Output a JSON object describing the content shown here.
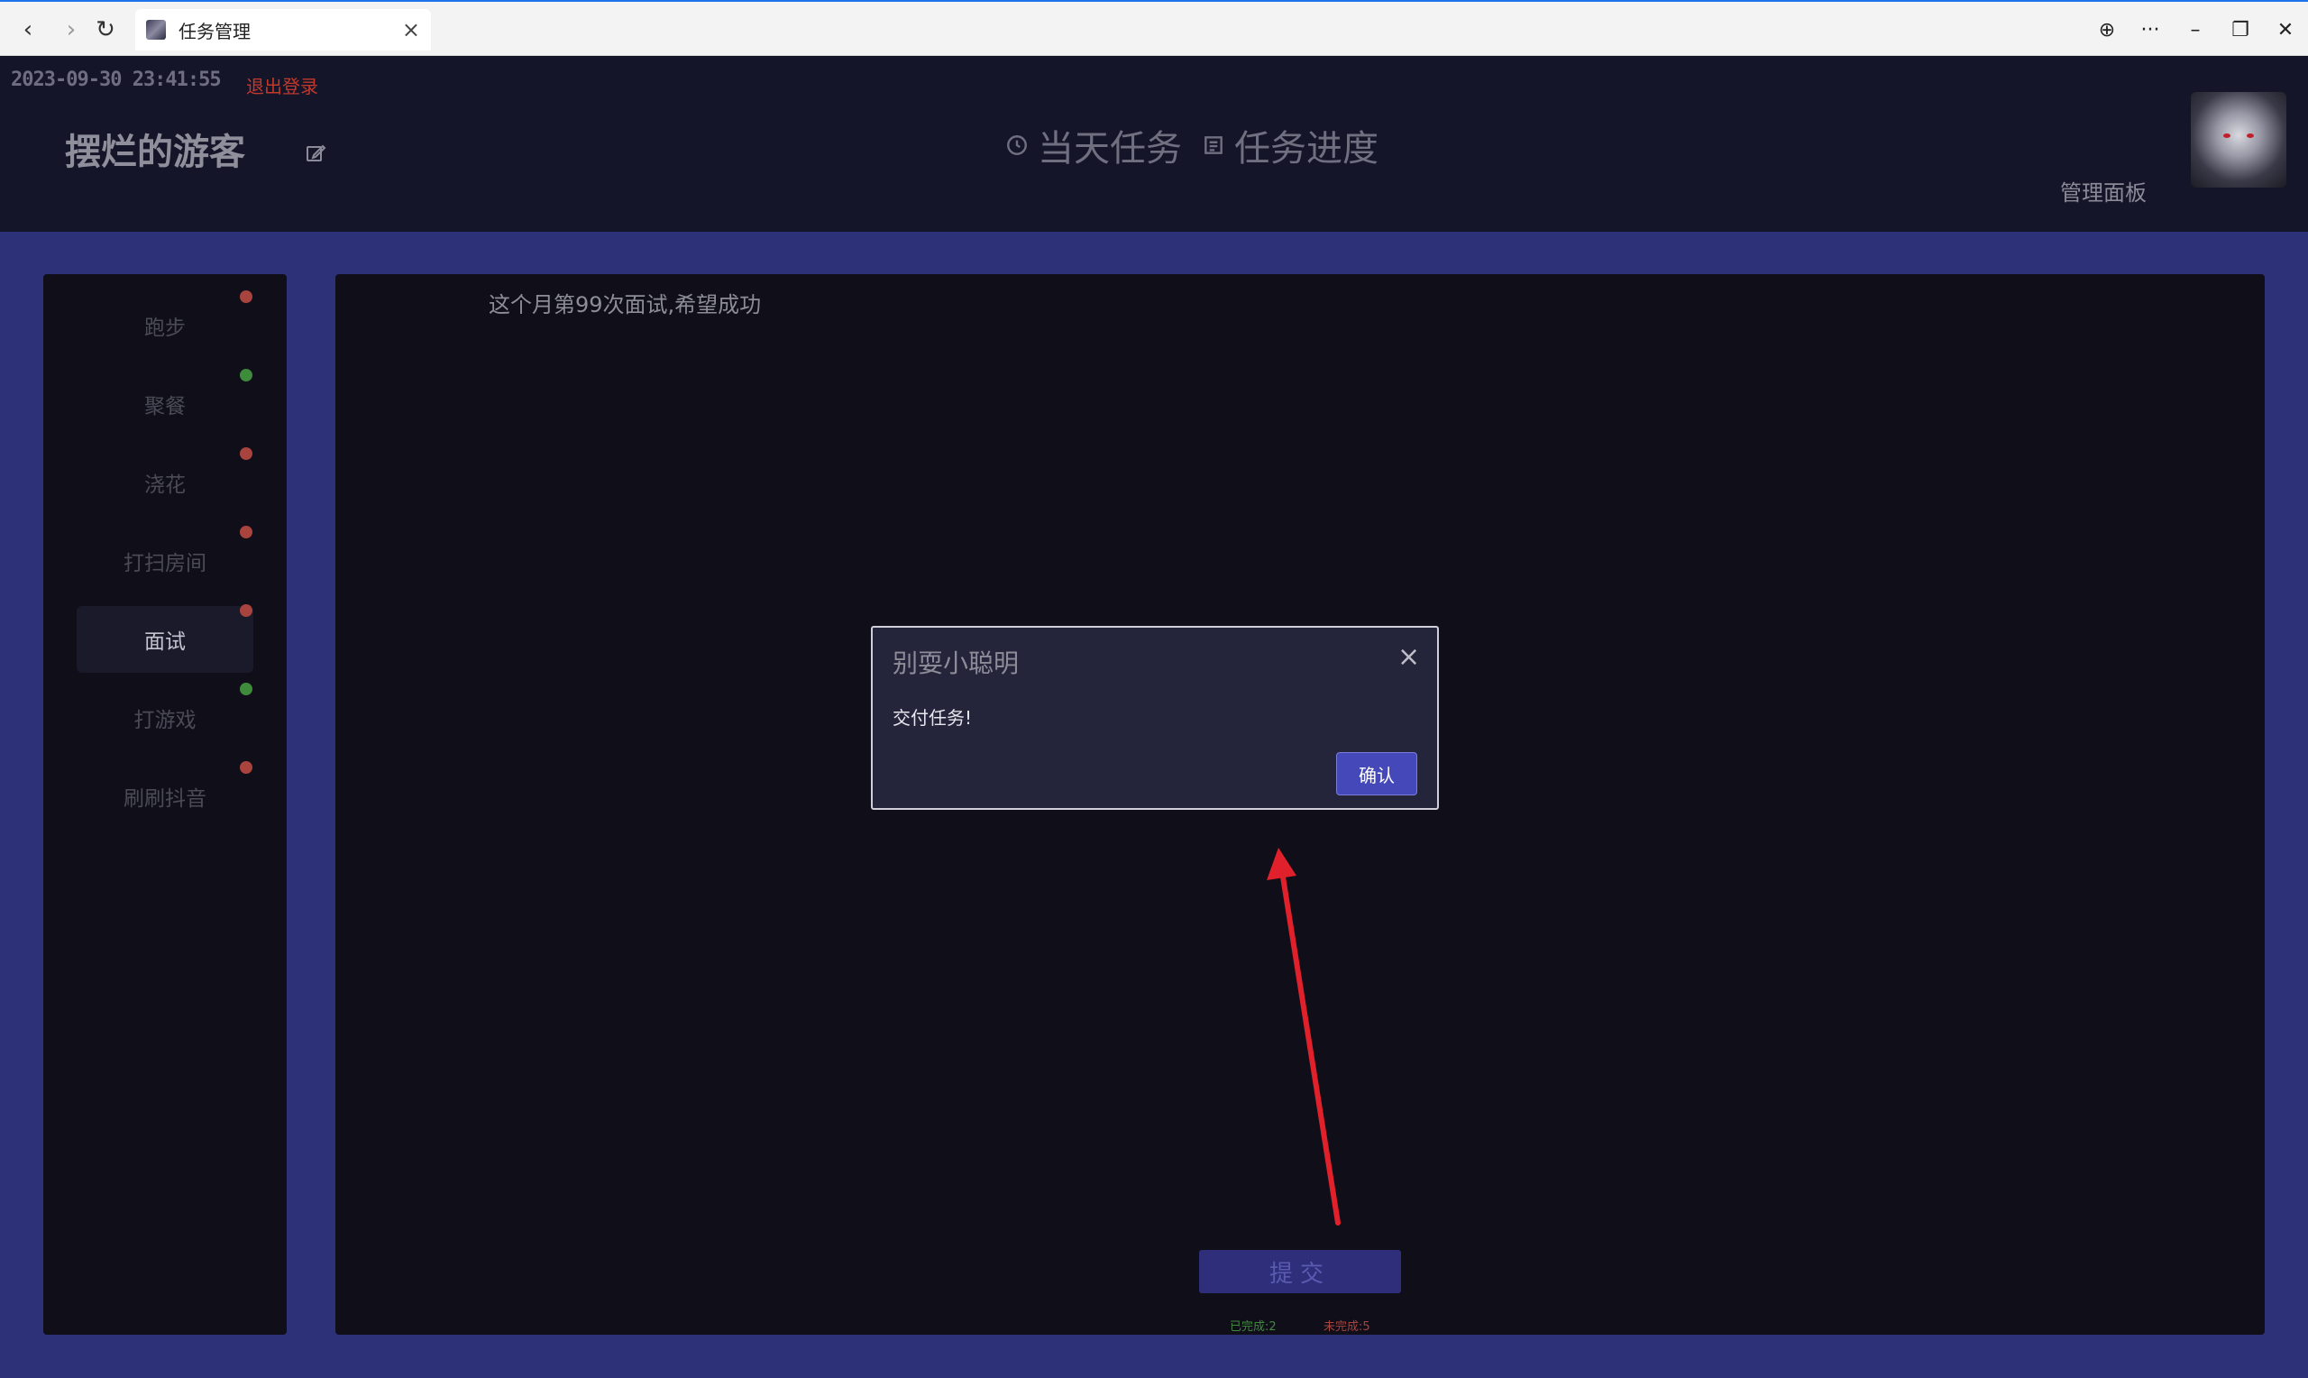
{
  "browser": {
    "tab_title": "任务管理",
    "tab_close": "×",
    "back": "‹",
    "forward": "›",
    "reload": "↻",
    "globe": "⊕",
    "more": "···",
    "minimize": "–",
    "restore": "❐",
    "close": "✕"
  },
  "header": {
    "datetime": "2023-09-30 23:41:55",
    "logout": "退出登录",
    "username": "摆烂的游客",
    "nav": [
      {
        "label": "当天任务",
        "icon": "clock-icon"
      },
      {
        "label": "任务进度",
        "icon": "document-icon"
      }
    ],
    "admin_link": "管理面板"
  },
  "sidebar": {
    "items": [
      {
        "label": "跑步",
        "status": "red"
      },
      {
        "label": "聚餐",
        "status": "green"
      },
      {
        "label": "浇花",
        "status": "red"
      },
      {
        "label": "打扫房间",
        "status": "red"
      },
      {
        "label": "面试",
        "status": "red",
        "active": true
      },
      {
        "label": "打游戏",
        "status": "green"
      },
      {
        "label": "刷刷抖音",
        "status": "red"
      }
    ]
  },
  "main": {
    "task_description": "这个月第99次面试,希望成功",
    "submit_label": "提交",
    "stats": {
      "done": "已完成:2",
      "undone": "未完成:5"
    }
  },
  "modal": {
    "title": "别耍小聪明",
    "close": "×",
    "body": "交付任务!",
    "confirm": "确认"
  },
  "colors": {
    "page_bg": "#2c3178",
    "panel_bg": "#0f0e19",
    "header_bg": "#15152a",
    "accent": "#4448b8",
    "status_red": "#a8443d",
    "status_green": "#3f8b3c",
    "annotation_arrow": "#e0202a"
  }
}
